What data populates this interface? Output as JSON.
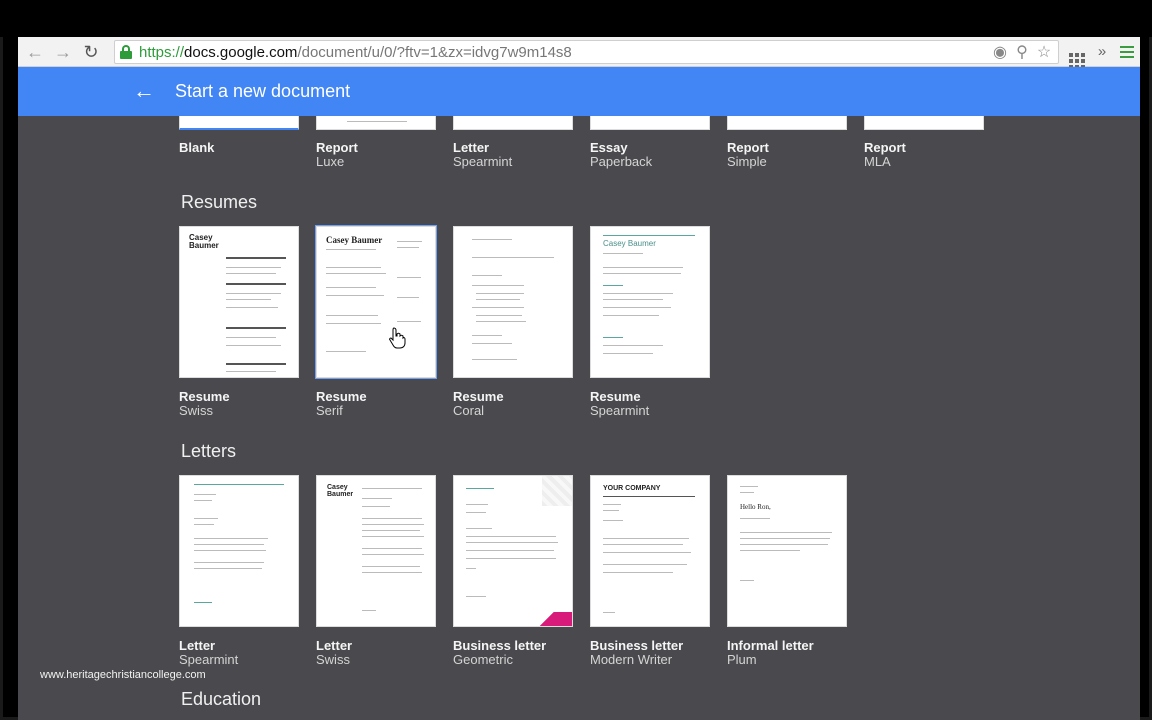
{
  "browser": {
    "url_scheme": "https://",
    "url_host": "docs.google.com",
    "url_path": "/document/u/0/?ftv=1&zx=idvg7w9m14s8",
    "icons": [
      "back-icon",
      "forward-icon",
      "reload-icon",
      "lock-icon",
      "lightbulb-icon",
      "zoom-icon",
      "star-icon",
      "apps-icon",
      "extensions-overflow-icon",
      "menu-icon"
    ]
  },
  "header": {
    "title": "Start a new document",
    "color": "#4285f4"
  },
  "general": [
    {
      "name": "Blank",
      "sub": ""
    },
    {
      "name": "Report",
      "sub": "Luxe"
    },
    {
      "name": "Letter",
      "sub": "Spearmint"
    },
    {
      "name": "Essay",
      "sub": "Paperback"
    },
    {
      "name": "Report",
      "sub": "Simple"
    },
    {
      "name": "Report",
      "sub": "MLA"
    }
  ],
  "resumes": {
    "title": "Resumes",
    "items": [
      {
        "name": "Resume",
        "sub": "Swiss",
        "preview_title": "Casey\nBaumer"
      },
      {
        "name": "Resume",
        "sub": "Serif",
        "preview_title": "Casey Baumer"
      },
      {
        "name": "Resume",
        "sub": "Coral",
        "preview_title": ""
      },
      {
        "name": "Resume",
        "sub": "Spearmint",
        "preview_title": "Casey Baumer"
      }
    ]
  },
  "letters": {
    "title": "Letters",
    "items": [
      {
        "name": "Letter",
        "sub": "Spearmint",
        "preview_title": ""
      },
      {
        "name": "Letter",
        "sub": "Swiss",
        "preview_title": "Casey\nBaumer"
      },
      {
        "name": "Business letter",
        "sub": "Geometric",
        "preview_title": ""
      },
      {
        "name": "Business letter",
        "sub": "Modern Writer",
        "preview_title": "YOUR COMPANY"
      },
      {
        "name": "Informal letter",
        "sub": "Plum",
        "preview_title": "Hello Ron,"
      }
    ]
  },
  "education": {
    "title": "Education"
  },
  "watermark": "www.heritagechristiancollege.com"
}
